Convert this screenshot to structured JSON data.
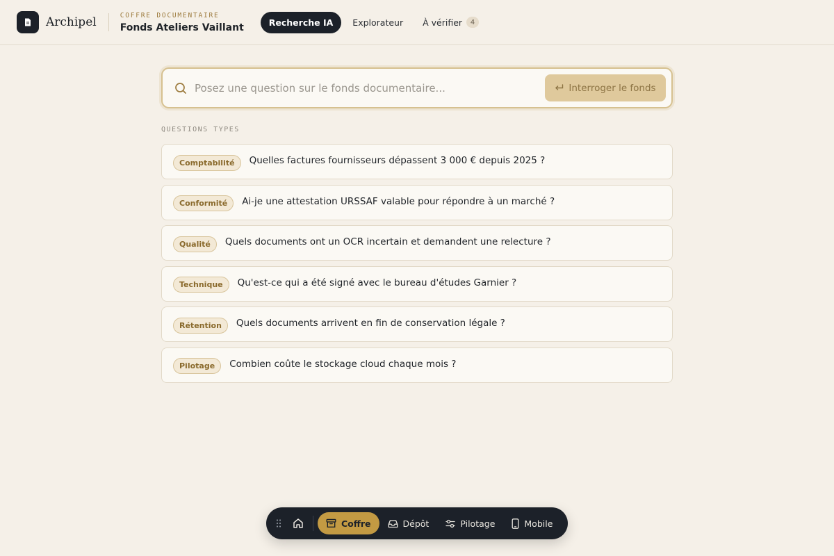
{
  "app": {
    "brand": "Archipel",
    "vault_kicker": "Coffre documentaire",
    "vault_name": "Fonds Ateliers Vaillant"
  },
  "nav": {
    "tabs": [
      {
        "label": "Recherche IA",
        "active": true
      },
      {
        "label": "Explorateur",
        "active": false
      },
      {
        "label": "À vérifier",
        "active": false,
        "badge": "4"
      }
    ]
  },
  "search": {
    "placeholder": "Posez une question sur le fonds documentaire...",
    "value": "",
    "button_label": "Interroger le fonds"
  },
  "questions": {
    "section_label": "Questions types",
    "items": [
      {
        "tag": "Comptabilité",
        "text": "Quelles factures fournisseurs dépassent 3 000 € depuis 2025 ?"
      },
      {
        "tag": "Conformité",
        "text": "Ai-je une attestation URSSAF valable pour répondre à un marché ?"
      },
      {
        "tag": "Qualité",
        "text": "Quels documents ont un OCR incertain et demandent une relecture ?"
      },
      {
        "tag": "Technique",
        "text": "Qu'est-ce qui a été signé avec le bureau d'études Garnier ?"
      },
      {
        "tag": "Rétention",
        "text": "Quels documents arrivent en fin de conservation légale ?"
      },
      {
        "tag": "Pilotage",
        "text": "Combien coûte le stockage cloud chaque mois ?"
      }
    ]
  },
  "dock": {
    "items": [
      {
        "label": "Coffre",
        "icon": "archive-icon",
        "active": true
      },
      {
        "label": "Dépôt",
        "icon": "inbox-icon",
        "active": false
      },
      {
        "label": "Pilotage",
        "icon": "sliders-icon",
        "active": false
      },
      {
        "label": "Mobile",
        "icon": "smartphone-icon",
        "active": false
      }
    ]
  },
  "colors": {
    "ink": "#1c2129",
    "accent": "#c39a43",
    "background": "#f5f0e8"
  }
}
